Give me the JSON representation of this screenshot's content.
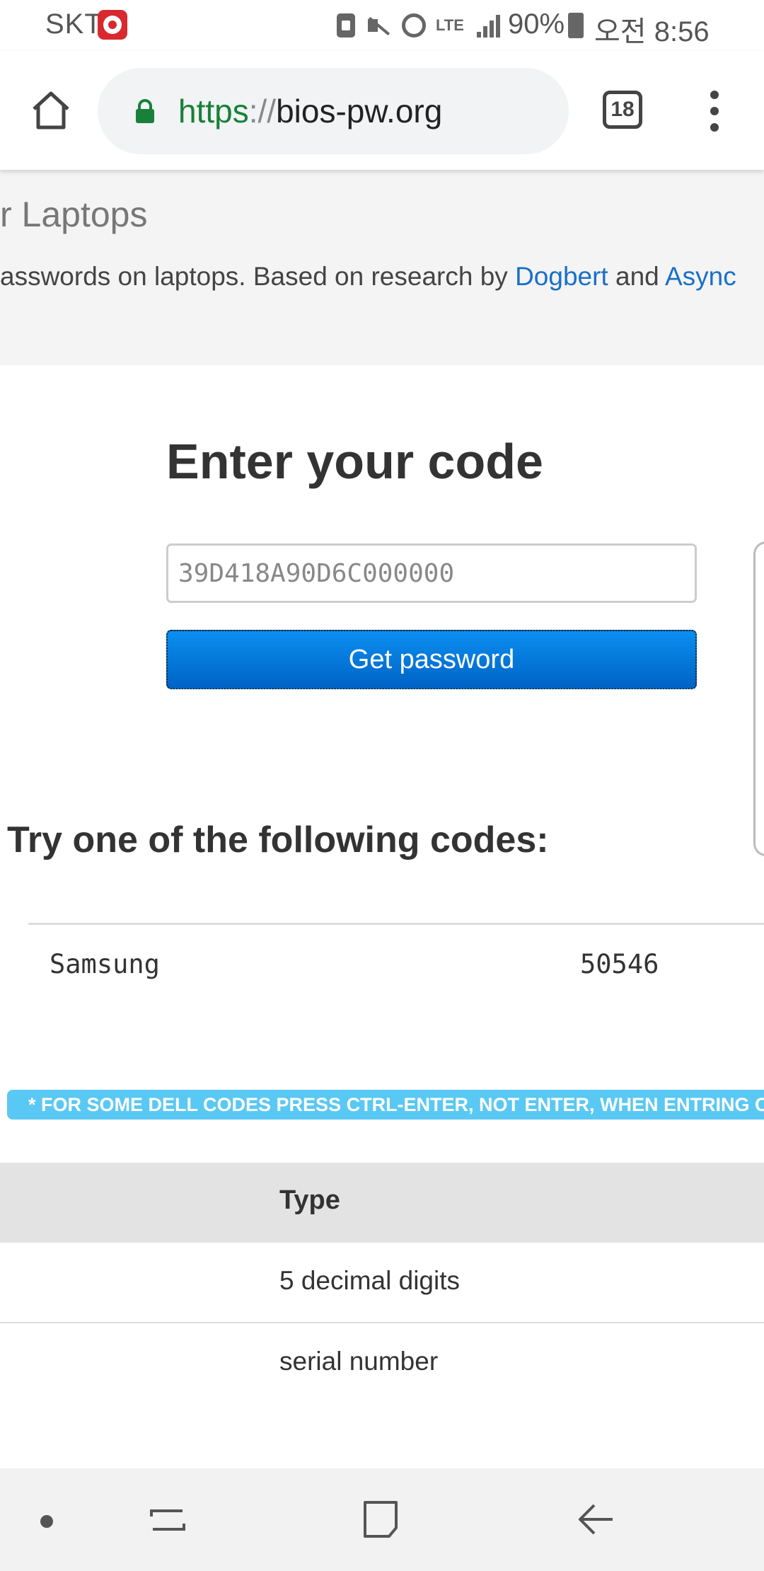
{
  "status_bar": {
    "carrier": "SKT",
    "battery": "90%",
    "time": "오전 8:56",
    "network": "LTE"
  },
  "browser": {
    "url_scheme": "https",
    "url_separator": "://",
    "url_host": "bios-pw.org",
    "tab_count": "18"
  },
  "hero": {
    "title": "r Laptops",
    "text_before": "asswords on laptops. Based on research by ",
    "link1": "Dogbert",
    "text_between": " and ",
    "link2": "Async"
  },
  "form": {
    "title": "Enter your code",
    "code_placeholder": "39D418A90D6C000000",
    "button_label": "Get password"
  },
  "results": {
    "title": "Try one of the following codes:",
    "rows": [
      {
        "brand": "Samsung",
        "code": "50546"
      }
    ]
  },
  "notice": "* FOR SOME DELL CODES PRESS CTRL-ENTER, NOT ENTER, WHEN ENTRING CODE",
  "type_table": {
    "header": "Type",
    "rows": [
      "5 decimal digits",
      "serial number"
    ]
  },
  "colors": {
    "link": "#1a6fc9",
    "button": "#0a7fe0",
    "notice_bg": "#5ac8f4",
    "https_green": "#188038"
  }
}
